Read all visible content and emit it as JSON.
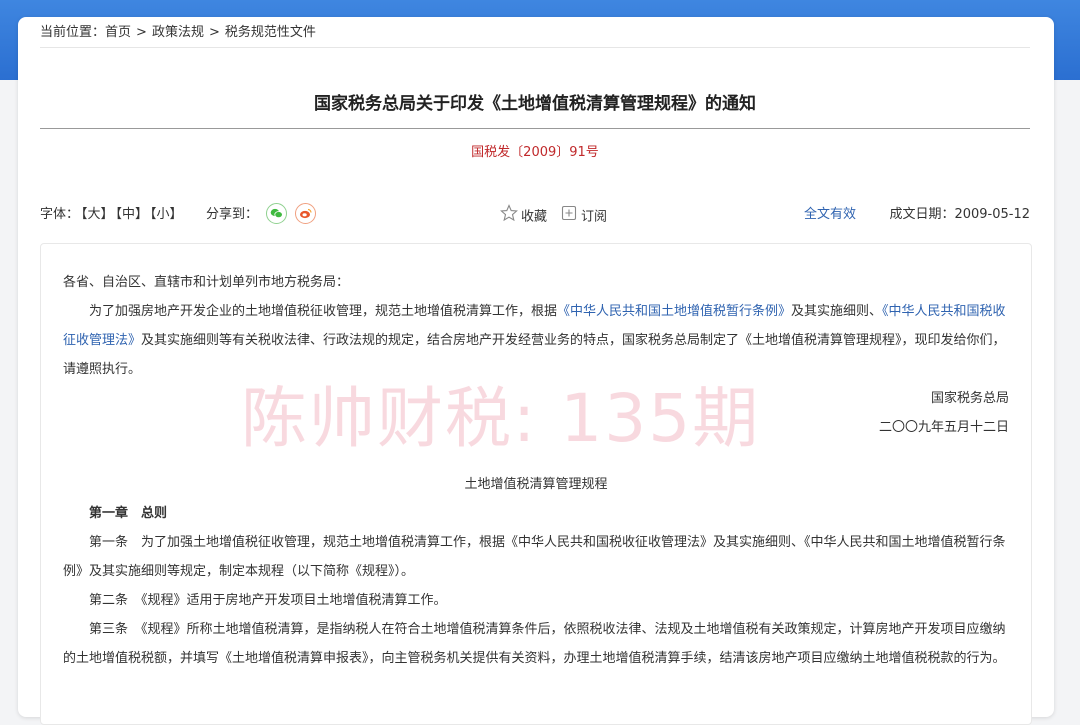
{
  "breadcrumb": {
    "label": "当前位置：",
    "items": [
      "首页",
      "政策法规",
      "税务规范性文件"
    ],
    "sep": ">"
  },
  "doc": {
    "title": "国家税务总局关于印发《土地增值税清算管理规程》的通知",
    "number": "国税发〔2009〕91号"
  },
  "toolbar": {
    "font_label": "字体：",
    "font_large": "【大】",
    "font_medium": "【中】",
    "font_small": "【小】",
    "share_label": "分享到：",
    "favorite": "收藏",
    "subscribe": "订阅",
    "validity": "全文有效",
    "date_label": "成文日期：2009-05-12"
  },
  "content": {
    "salutation": "各省、自治区、直辖市和计划单列市地方税务局：",
    "p1_a": "为了加强房地产开发企业的土地增值税征收管理，规范土地增值税清算工作，根据",
    "p1_link1": "《中华人民共和国土地增值税暂行条例》",
    "p1_b": "及其实施细则、",
    "p1_link2": "《中华人民共和国税收征收管理法》",
    "p1_c": "及其实施细则等有关税收法律、行政法规的规定，结合房地产开发经营业务的特点，国家税务总局制定了《土地增值税清算管理规程》，现印发给你们，请遵照执行。",
    "signer": "国家税务总局",
    "sign_date": "二〇〇九年五月十二日",
    "rules_title": "土地增值税清算管理规程",
    "chapter1": "第一章　总则",
    "art1": "第一条　为了加强土地增值税征收管理，规范土地增值税清算工作，根据《中华人民共和国税收征收管理法》及其实施细则、《中华人民共和国土地增值税暂行条例》及其实施细则等规定，制定本规程（以下简称《规程》）。",
    "art2": "第二条　《规程》适用于房地产开发项目土地增值税清算工作。",
    "art3": "第三条　《规程》所称土地增值税清算，是指纳税人在符合土地增值税清算条件后，依照税收法律、法规及土地增值税有关政策规定，计算房地产开发项目应缴纳的土地增值税税额，并填写《土地增值税清算申报表》，向主管税务机关提供有关资料，办理土地增值税清算手续，结清该房地产项目应缴纳土地增值税税款的行为。"
  },
  "watermark": "陈帅财税: 135期",
  "colors": {
    "header_blue": "#2b6fd1",
    "doc_number_red": "#c0292b",
    "link_blue": "#2f63b0"
  }
}
